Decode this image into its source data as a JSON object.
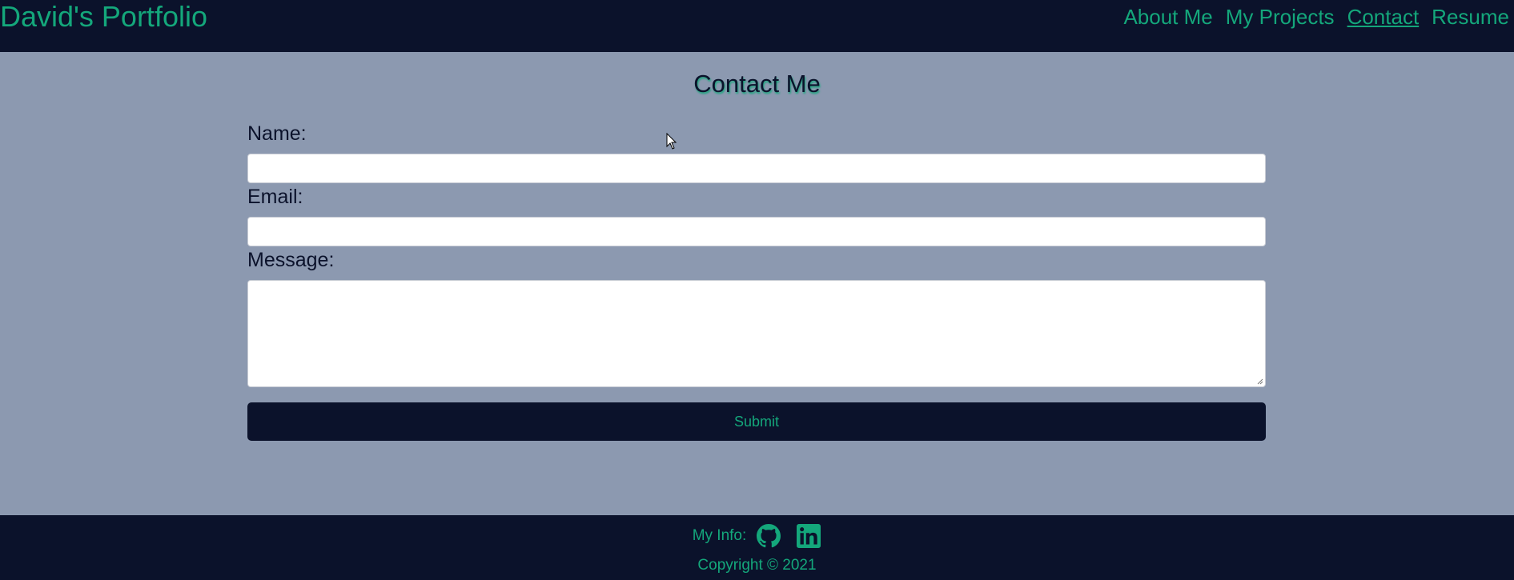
{
  "header": {
    "brand": "David's Portfolio",
    "nav": [
      {
        "label": "About Me",
        "active": false
      },
      {
        "label": "My Projects",
        "active": false
      },
      {
        "label": "Contact",
        "active": true
      },
      {
        "label": "Resume",
        "active": false
      }
    ]
  },
  "contact": {
    "title": "Contact Me",
    "name_label": "Name:",
    "name_value": "",
    "email_label": "Email:",
    "email_value": "",
    "message_label": "Message:",
    "message_value": "",
    "submit_label": "Submit"
  },
  "footer": {
    "info_label": "My Info:",
    "links": [
      {
        "icon": "github-icon"
      },
      {
        "icon": "linkedin-icon"
      }
    ],
    "copyright": "Copyright © 2021"
  },
  "colors": {
    "navy": "#0b122b",
    "accent": "#14a77b",
    "page_bg": "#8c99b0"
  }
}
